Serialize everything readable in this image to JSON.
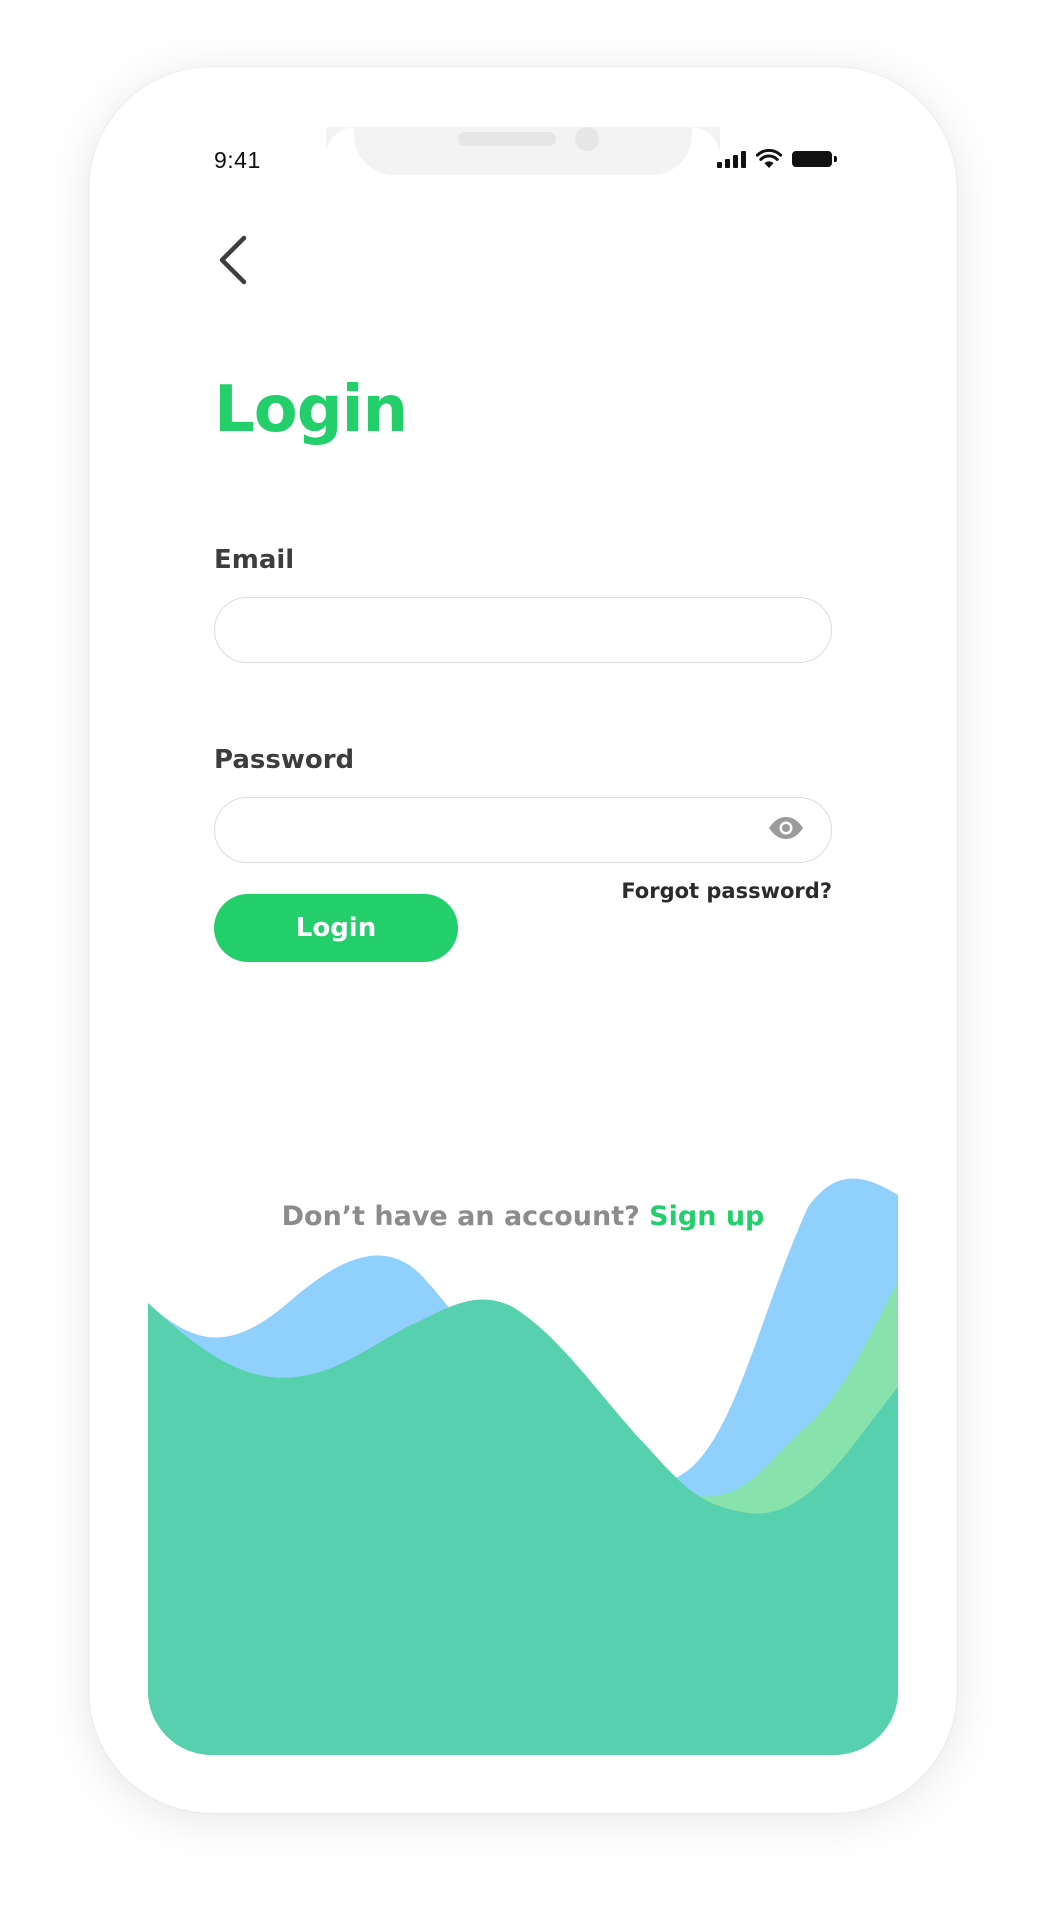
{
  "status_bar": {
    "time": "9:41",
    "signal_icon": "cellular-signal-icon",
    "wifi_icon": "wifi-icon",
    "battery_icon": "battery-icon"
  },
  "nav": {
    "back_icon": "chevron-left-icon"
  },
  "title": "Login",
  "email": {
    "label": "Email",
    "value": "",
    "placeholder": ""
  },
  "password": {
    "label": "Password",
    "value": "",
    "placeholder": "",
    "toggle_icon": "eye-icon"
  },
  "forgot_password": "Forgot password?",
  "login_button": "Login",
  "signup": {
    "prompt": "Don’t have an account?",
    "link": "Sign up"
  },
  "colors": {
    "accent": "#22cf6b",
    "wave_blue": "#8fd0fd",
    "wave_green": "#87e2ac",
    "wave_teal": "#57d0ad",
    "label_text": "#3d3d3d",
    "muted_text": "#8c8c8c"
  }
}
